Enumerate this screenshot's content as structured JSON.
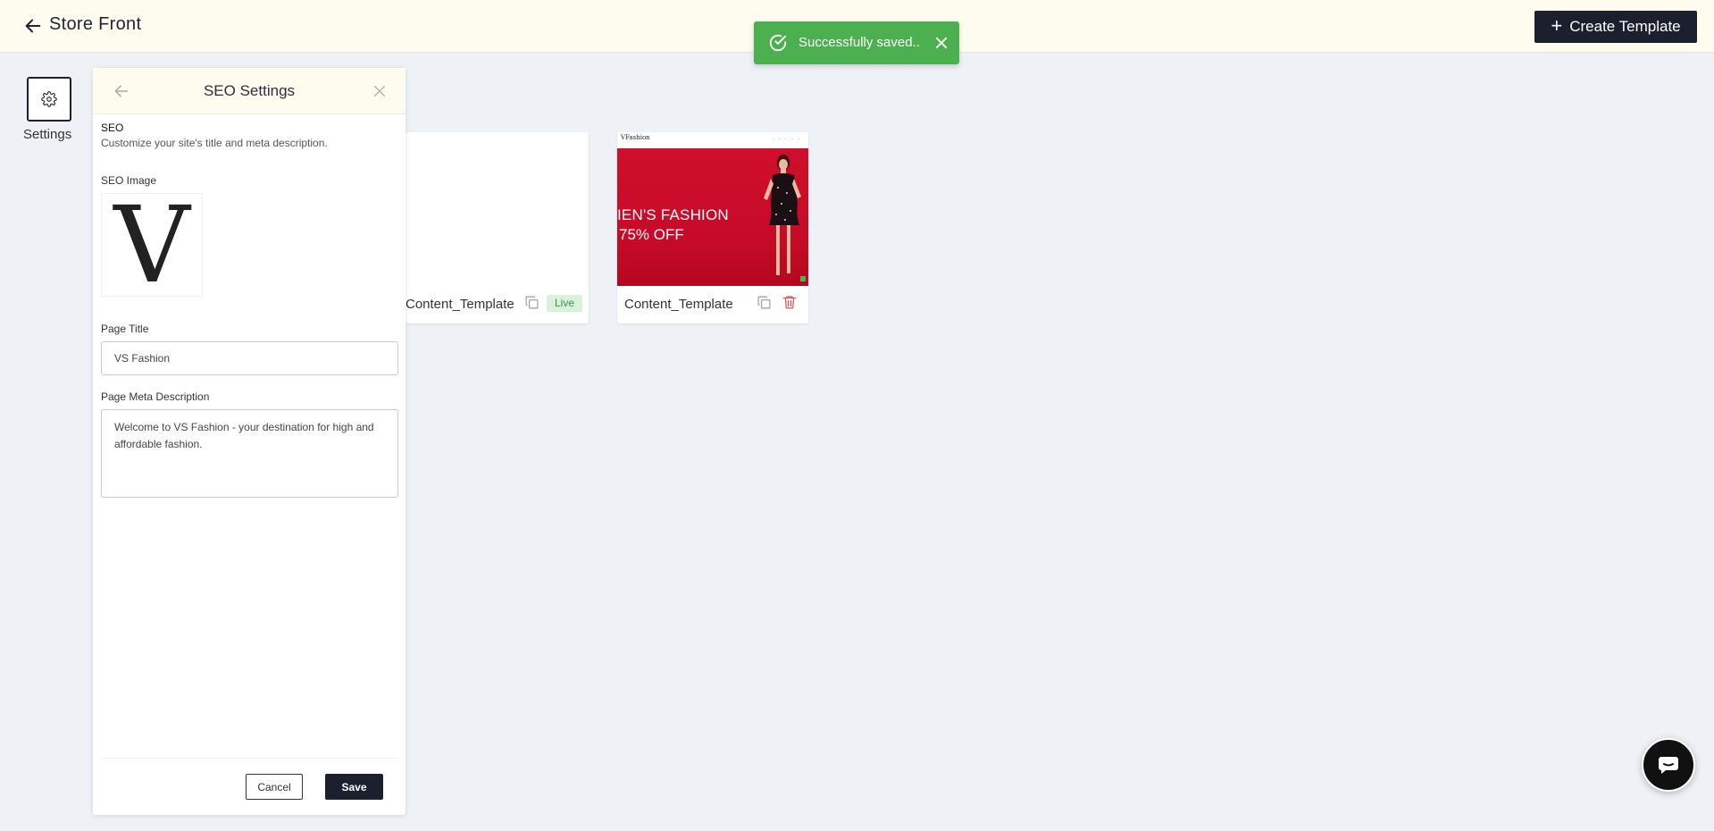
{
  "header": {
    "title": "Store Front",
    "create_button_label": "Create Template"
  },
  "toast": {
    "message": "Successfully saved..",
    "color": "#4caf50"
  },
  "sidebar": {
    "settings_label": "Settings"
  },
  "seo_panel": {
    "title": "SEO Settings",
    "section_heading": "SEO",
    "section_description": "Customize your site's title and meta description.",
    "image_label": "SEO Image",
    "image_letter": "V",
    "page_title_label": "Page Title",
    "page_title_value": "VS Fashion",
    "meta_description_label": "Page Meta Description",
    "meta_description_value": "Welcome to VS Fashion - your destination for high and affordable fashion.",
    "cancel_label": "Cancel",
    "save_label": "Save"
  },
  "templates": [
    {
      "name": "Content_Template",
      "status": "Live"
    },
    {
      "name": "Content_Template",
      "thumbnail": {
        "logo": "VFashion",
        "banner_line1": "IEN'S FASHION",
        "banner_line2": "75% OFF",
        "banner_color": "#c8102e"
      }
    }
  ],
  "colors": {
    "header_bg": "#fefcef",
    "primary_dark": "#1c1f2e",
    "live_badge_bg": "#d9f2dc",
    "delete_red": "#e05252"
  }
}
